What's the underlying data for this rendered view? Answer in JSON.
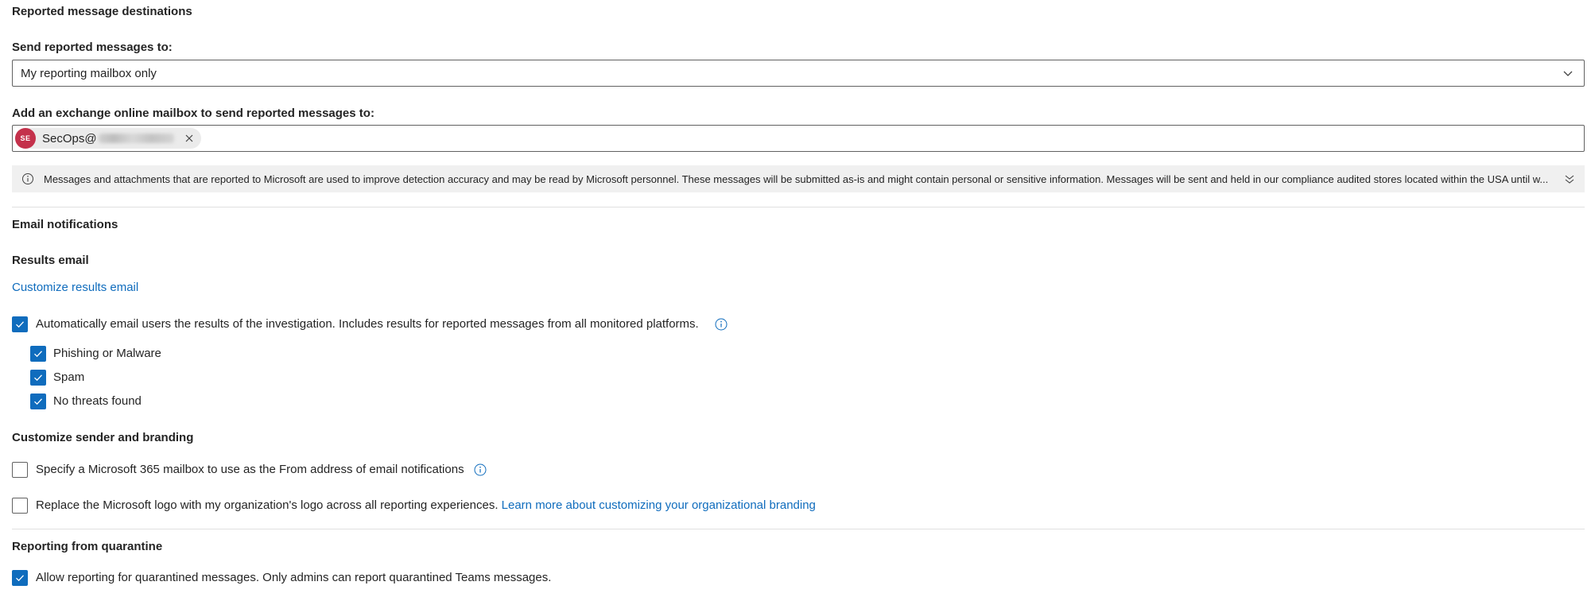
{
  "destinations": {
    "heading": "Reported message destinations",
    "send_label": "Send reported messages to:",
    "send_value": "My reporting mailbox only",
    "mailbox_label": "Add an exchange online mailbox to send reported messages to:",
    "mailbox_chip": {
      "initials": "SE",
      "name": "SecOps@",
      "avatar_color": "#c4314b"
    },
    "info_message": "Messages and attachments that are reported to Microsoft are used to improve detection accuracy and may be read by Microsoft personnel. These messages will be submitted as-is and might contain personal or sensitive information. Messages will be sent and held in our compliance audited stores located within the USA until w..."
  },
  "email_notifications": {
    "heading": "Email notifications",
    "results_email_label": "Results email",
    "customize_link": "Customize results email",
    "auto_email": {
      "label": "Automatically email users the results of the investigation. Includes results for reported messages from all monitored platforms.",
      "checked": true
    },
    "verdicts": [
      {
        "label": "Phishing or Malware",
        "checked": true
      },
      {
        "label": "Spam",
        "checked": true
      },
      {
        "label": "No threats found",
        "checked": true
      }
    ],
    "branding_heading": "Customize sender and branding",
    "from_mailbox": {
      "label": "Specify a Microsoft 365 mailbox to use as the From address of email notifications",
      "checked": false
    },
    "logo": {
      "label": "Replace the Microsoft logo with my organization's logo across all reporting experiences.",
      "link": "Learn more about customizing your organizational branding",
      "checked": false
    }
  },
  "quarantine": {
    "heading": "Reporting from quarantine",
    "allow": {
      "label": "Allow reporting for quarantined messages. Only admins can report quarantined Teams messages.",
      "checked": true
    }
  },
  "colors": {
    "accent": "#0f6cbd",
    "text": "#242424",
    "info_bar_bg": "#f0f0f0"
  },
  "icons": {
    "dropdown": "chevron-down-icon",
    "remove": "close-icon",
    "info": "info-icon",
    "expand": "double-chevron-down-icon",
    "check": "checkmark-icon"
  }
}
